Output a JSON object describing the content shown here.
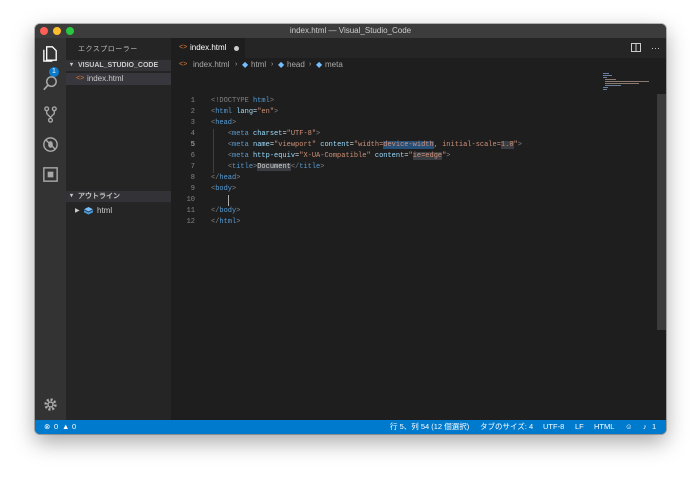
{
  "window": {
    "title": "index.html — Visual_Studio_Code"
  },
  "activity_bar": {
    "badge": "1",
    "icons": [
      "files-icon",
      "search-icon",
      "source-control-icon",
      "debug-icon",
      "extensions-icon",
      "gear-icon"
    ]
  },
  "sidebar": {
    "title": "エクスプローラー",
    "folder_section": "VISUAL_STUDIO_CODE",
    "files": [
      {
        "icon": "<>",
        "name": "index.html"
      }
    ],
    "outline_section": "アウトライン",
    "outline_items": [
      {
        "name": "html"
      }
    ]
  },
  "tabs": [
    {
      "icon": "<>",
      "label": "index.html",
      "modified": true
    }
  ],
  "breadcrumb": [
    "index.html",
    "html",
    "head",
    "meta"
  ],
  "editor": {
    "current_line": 5,
    "lines": [
      [
        {
          "t": "<!DOCTYPE ",
          "c": "#808080"
        },
        {
          "t": "html",
          "c": "#569cd6"
        },
        {
          "t": ">",
          "c": "#808080"
        }
      ],
      [
        {
          "t": "<",
          "c": "#808080"
        },
        {
          "t": "html",
          "c": "#569cd6"
        },
        {
          "t": " lang",
          "c": "#9cdcfe"
        },
        {
          "t": "=",
          "c": "#d4d4d4"
        },
        {
          "t": "\"en\"",
          "c": "#ce9178"
        },
        {
          "t": ">",
          "c": "#808080"
        }
      ],
      [
        {
          "t": "<",
          "c": "#808080"
        },
        {
          "t": "head",
          "c": "#569cd6"
        },
        {
          "t": ">",
          "c": "#808080"
        }
      ],
      [
        {
          "t": "    ",
          "c": "#d4d4d4"
        },
        {
          "t": "<",
          "c": "#808080"
        },
        {
          "t": "meta",
          "c": "#569cd6"
        },
        {
          "t": " charset",
          "c": "#9cdcfe"
        },
        {
          "t": "=",
          "c": "#d4d4d4"
        },
        {
          "t": "\"UTF-8\"",
          "c": "#ce9178"
        },
        {
          "t": ">",
          "c": "#808080"
        }
      ],
      [
        {
          "t": "    ",
          "c": "#d4d4d4"
        },
        {
          "t": "<",
          "c": "#808080"
        },
        {
          "t": "meta",
          "c": "#569cd6"
        },
        {
          "t": " name",
          "c": "#9cdcfe"
        },
        {
          "t": "=",
          "c": "#d4d4d4"
        },
        {
          "t": "\"viewport\"",
          "c": "#ce9178"
        },
        {
          "t": " content",
          "c": "#9cdcfe"
        },
        {
          "t": "=",
          "c": "#d4d4d4"
        },
        {
          "t": "\"width=",
          "c": "#ce9178"
        },
        {
          "t": "device-width",
          "c": "#ce9178",
          "hl": true
        },
        {
          "t": ", initial-scale=",
          "c": "#ce9178"
        },
        {
          "t": "1.0",
          "c": "#ce9178",
          "hl2": true
        },
        {
          "t": "\"",
          "c": "#ce9178"
        },
        {
          "t": ">",
          "c": "#808080"
        }
      ],
      [
        {
          "t": "    ",
          "c": "#d4d4d4"
        },
        {
          "t": "<",
          "c": "#808080"
        },
        {
          "t": "meta",
          "c": "#569cd6"
        },
        {
          "t": " http-equiv",
          "c": "#9cdcfe"
        },
        {
          "t": "=",
          "c": "#d4d4d4"
        },
        {
          "t": "\"X-UA-Compatible\"",
          "c": "#ce9178"
        },
        {
          "t": " content",
          "c": "#9cdcfe"
        },
        {
          "t": "=",
          "c": "#d4d4d4"
        },
        {
          "t": "\"",
          "c": "#ce9178"
        },
        {
          "t": "ie=edge",
          "c": "#ce9178",
          "hl2": true
        },
        {
          "t": "\"",
          "c": "#ce9178"
        },
        {
          "t": ">",
          "c": "#808080"
        }
      ],
      [
        {
          "t": "    ",
          "c": "#d4d4d4"
        },
        {
          "t": "<",
          "c": "#808080"
        },
        {
          "t": "title",
          "c": "#569cd6"
        },
        {
          "t": ">",
          "c": "#808080"
        },
        {
          "t": "Document",
          "c": "#d4d4d4",
          "hl2": true
        },
        {
          "t": "</",
          "c": "#808080"
        },
        {
          "t": "title",
          "c": "#569cd6"
        },
        {
          "t": ">",
          "c": "#808080"
        }
      ],
      [
        {
          "t": "</",
          "c": "#808080"
        },
        {
          "t": "head",
          "c": "#569cd6"
        },
        {
          "t": ">",
          "c": "#808080"
        }
      ],
      [
        {
          "t": "<",
          "c": "#808080"
        },
        {
          "t": "body",
          "c": "#569cd6"
        },
        {
          "t": ">",
          "c": "#808080"
        }
      ],
      [
        {
          "t": "    ",
          "c": "#d4d4d4"
        }
      ],
      [
        {
          "t": "</",
          "c": "#808080"
        },
        {
          "t": "body",
          "c": "#569cd6"
        },
        {
          "t": ">",
          "c": "#808080"
        }
      ],
      [
        {
          "t": "</",
          "c": "#808080"
        },
        {
          "t": "html",
          "c": "#569cd6"
        },
        {
          "t": ">",
          "c": "#808080"
        }
      ]
    ]
  },
  "statusbar": {
    "errors": "0",
    "warnings": "0",
    "position": "行 5、列 54 (12 個選択)",
    "tab_size": "タブのサイズ: 4",
    "encoding": "UTF-8",
    "eol": "LF",
    "language": "HTML",
    "notifications": "1"
  },
  "colors": {
    "accent": "#007acc",
    "bg": "#1e1e1e",
    "sidebar": "#252526",
    "activity": "#333333"
  }
}
